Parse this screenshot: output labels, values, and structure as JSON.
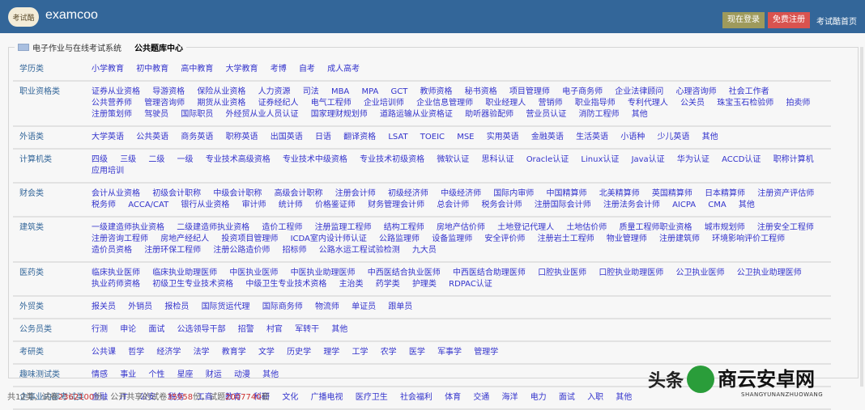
{
  "header": {
    "logo_text": "考试酷",
    "brand": "examcoo",
    "login_label": "现在登录",
    "register_label": "免费注册",
    "home_label": "考试酷首页"
  },
  "legend": {
    "system": "电子作业与在线考试系统",
    "current": "公共题库中心"
  },
  "categories": [
    {
      "name": "学历类",
      "items": [
        "小学教育",
        "初中教育",
        "高中教育",
        "大学教育",
        "考博",
        "自考",
        "成人高考"
      ]
    },
    {
      "name": "职业资格类",
      "items": [
        "证券从业资格",
        "导游资格",
        "保险从业资格",
        "人力资源",
        "司法",
        "MBA",
        "MPA",
        "GCT",
        "教师资格",
        "秘书资格",
        "项目管理师",
        "电子商务师",
        "企业法律顾问",
        "心理咨询师",
        "社会工作者",
        "公共营养师",
        "管理咨询师",
        "期货从业资格",
        "证券经纪人",
        "电气工程师",
        "企业培训师",
        "企业信息管理师",
        "职业经理人",
        "营销师",
        "职业指导师",
        "专利代理人",
        "公关员",
        "珠宝玉石检验师",
        "拍卖师",
        "注册策划师",
        "驾驶员",
        "国际职员",
        "外经贸从业人员认证",
        "国家理财规划师",
        "道路运输从业资格证",
        "助听器验配师",
        "营业员认证",
        "消防工程师",
        "其他"
      ]
    },
    {
      "name": "外语类",
      "items": [
        "大学英语",
        "公共英语",
        "商务英语",
        "职称英语",
        "出国英语",
        "日语",
        "翻译资格",
        "LSAT",
        "TOEIC",
        "MSE",
        "实用英语",
        "金融英语",
        "生活英语",
        "小语种",
        "少儿英语",
        "其他"
      ]
    },
    {
      "name": "计算机类",
      "items": [
        "四级",
        "三级",
        "二级",
        "一级",
        "专业技术高级资格",
        "专业技术中级资格",
        "专业技术初级资格",
        "微软认证",
        "思科认证",
        "Oracle认证",
        "Linux认证",
        "Java认证",
        "华为认证",
        "ACCD认证",
        "职称计算机",
        "应用培训"
      ]
    },
    {
      "name": "财会类",
      "items": [
        "会计从业资格",
        "初级会计职称",
        "中级会计职称",
        "高级会计职称",
        "注册会计师",
        "初级经济师",
        "中级经济师",
        "国际内审师",
        "中国精算师",
        "北美精算师",
        "英国精算师",
        "日本精算师",
        "注册资产评估师",
        "税务师",
        "ACCA/CAT",
        "银行从业资格",
        "审计师",
        "统计师",
        "价格鉴证师",
        "财务管理会计师",
        "总会计师",
        "税务会计师",
        "注册国际会计师",
        "注册法务会计师",
        "AICPA",
        "CMA",
        "其他"
      ]
    },
    {
      "name": "建筑类",
      "items": [
        "一级建造师执业资格",
        "二级建造师执业资格",
        "造价工程师",
        "注册监理工程师",
        "结构工程师",
        "房地产估价师",
        "土地登记代理人",
        "土地估价师",
        "质量工程师职业资格",
        "城市规划师",
        "注册安全工程师",
        "注册咨询工程师",
        "房地产经纪人",
        "投资项目管理师",
        "ICDA室内设计师认证",
        "公路监理师",
        "设备监理师",
        "安全评价师",
        "注册岩土工程师",
        "物业管理师",
        "注册建筑师",
        "环境影响评价工程师",
        "造价员资格",
        "注册环保工程师",
        "注册公路造价师",
        "招标师",
        "公路水运工程试验检测",
        "九大员"
      ]
    },
    {
      "name": "医药类",
      "items": [
        "临床执业医师",
        "临床执业助理医师",
        "中医执业医师",
        "中医执业助理医师",
        "中西医结合执业医师",
        "中西医结合助理医师",
        "口腔执业医师",
        "口腔执业助理医师",
        "公卫执业医师",
        "公卫执业助理医师",
        "执业药师资格",
        "初级卫生专业技术资格",
        "中级卫生专业技术资格",
        "主治类",
        "药学类",
        "护理类",
        "RDPAC认证"
      ]
    },
    {
      "name": "外贸类",
      "items": [
        "报关员",
        "外销员",
        "报检员",
        "国际货运代理",
        "国际商务师",
        "物流师",
        "单证员",
        "跟单员"
      ]
    },
    {
      "name": "公务员类",
      "items": [
        "行测",
        "申论",
        "面试",
        "公选领导干部",
        "招警",
        "村官",
        "军转干",
        "其他"
      ]
    },
    {
      "name": "考研类",
      "items": [
        "公共课",
        "哲学",
        "经济学",
        "法学",
        "教育学",
        "文学",
        "历史学",
        "理学",
        "工学",
        "农学",
        "医学",
        "军事学",
        "管理学"
      ]
    },
    {
      "name": "趣味测试类",
      "items": [
        "情感",
        "事业",
        "个性",
        "星座",
        "财运",
        "动漫",
        "其他"
      ]
    },
    {
      "name": "企事业内部考试类",
      "items": [
        "金融",
        "IT",
        "公安",
        "税务",
        "工商",
        "教育",
        "科研",
        "文化",
        "广播电视",
        "医疗卫生",
        "社会福利",
        "体育",
        "交通",
        "海洋",
        "电力",
        "面试",
        "入职",
        "其他"
      ]
    }
  ],
  "footer": {
    "prefix": "共12类，试卷",
    "papers": "2362100",
    "mid1": "份，公开共享的试卷",
    "shared": "35958",
    "mid2": "份，试题",
    "questions": "2007740",
    "suffix": "套"
  },
  "watermark": {
    "left": "头条",
    "right": "商云安卓网",
    "sub": "SHANGYUNANZHUOWANG"
  }
}
